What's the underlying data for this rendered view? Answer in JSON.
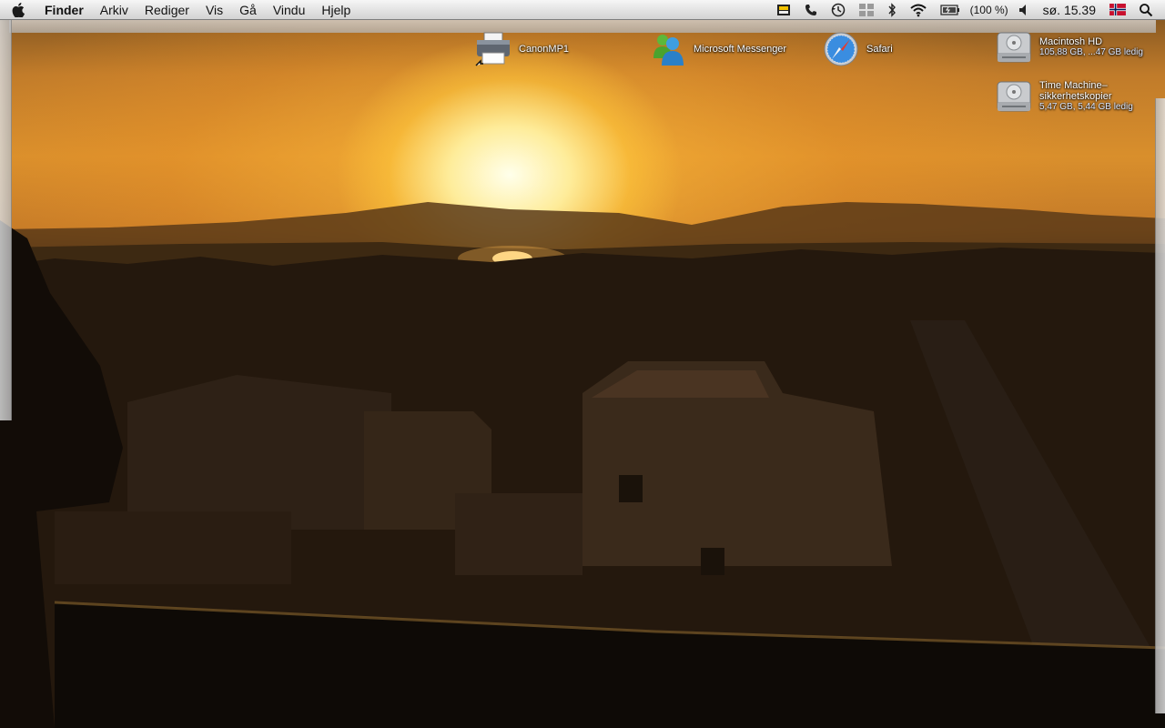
{
  "menubar": {
    "apple_icon": "apple-logo-icon",
    "app_name": "Finder",
    "items": [
      "Arkiv",
      "Rediger",
      "Vis",
      "Gå",
      "Vindu",
      "Hjelp"
    ],
    "status": {
      "battery_percent": "(100 %)",
      "clock": "sø. 15.39",
      "icons": [
        "menu-extra-icon",
        "phone-icon",
        "time-machine-icon",
        "spaces-icon",
        "bluetooth-icon",
        "wifi-icon",
        "battery-icon",
        "volume-icon",
        "norwegian-flag-icon",
        "spotlight-search-icon"
      ]
    }
  },
  "desktop": {
    "top_icons": [
      {
        "label": "CanonMP1",
        "icon": "printer-icon"
      },
      {
        "label": "Microsoft Messenger",
        "icon": "messenger-icon"
      },
      {
        "label": "Safari",
        "icon": "safari-compass-icon"
      }
    ],
    "drives": [
      {
        "name": "Macintosh HD",
        "info": "105,88 GB, ...47 GB ledig",
        "icon": "hard-drive-icon"
      },
      {
        "name_line1": "Time Machine–",
        "name_line2": "sikkerhetskopier",
        "info": "5,47 GB, 5,44 GB ledig",
        "icon": "hard-drive-icon"
      }
    ]
  },
  "colors": {
    "menubar_top": "#f6f6f6",
    "menubar_bottom": "#d3d3d3",
    "sun": "#fff6d0",
    "sky": "#d98f2c",
    "flag_red": "#c8102e",
    "flag_blue": "#00205b"
  }
}
